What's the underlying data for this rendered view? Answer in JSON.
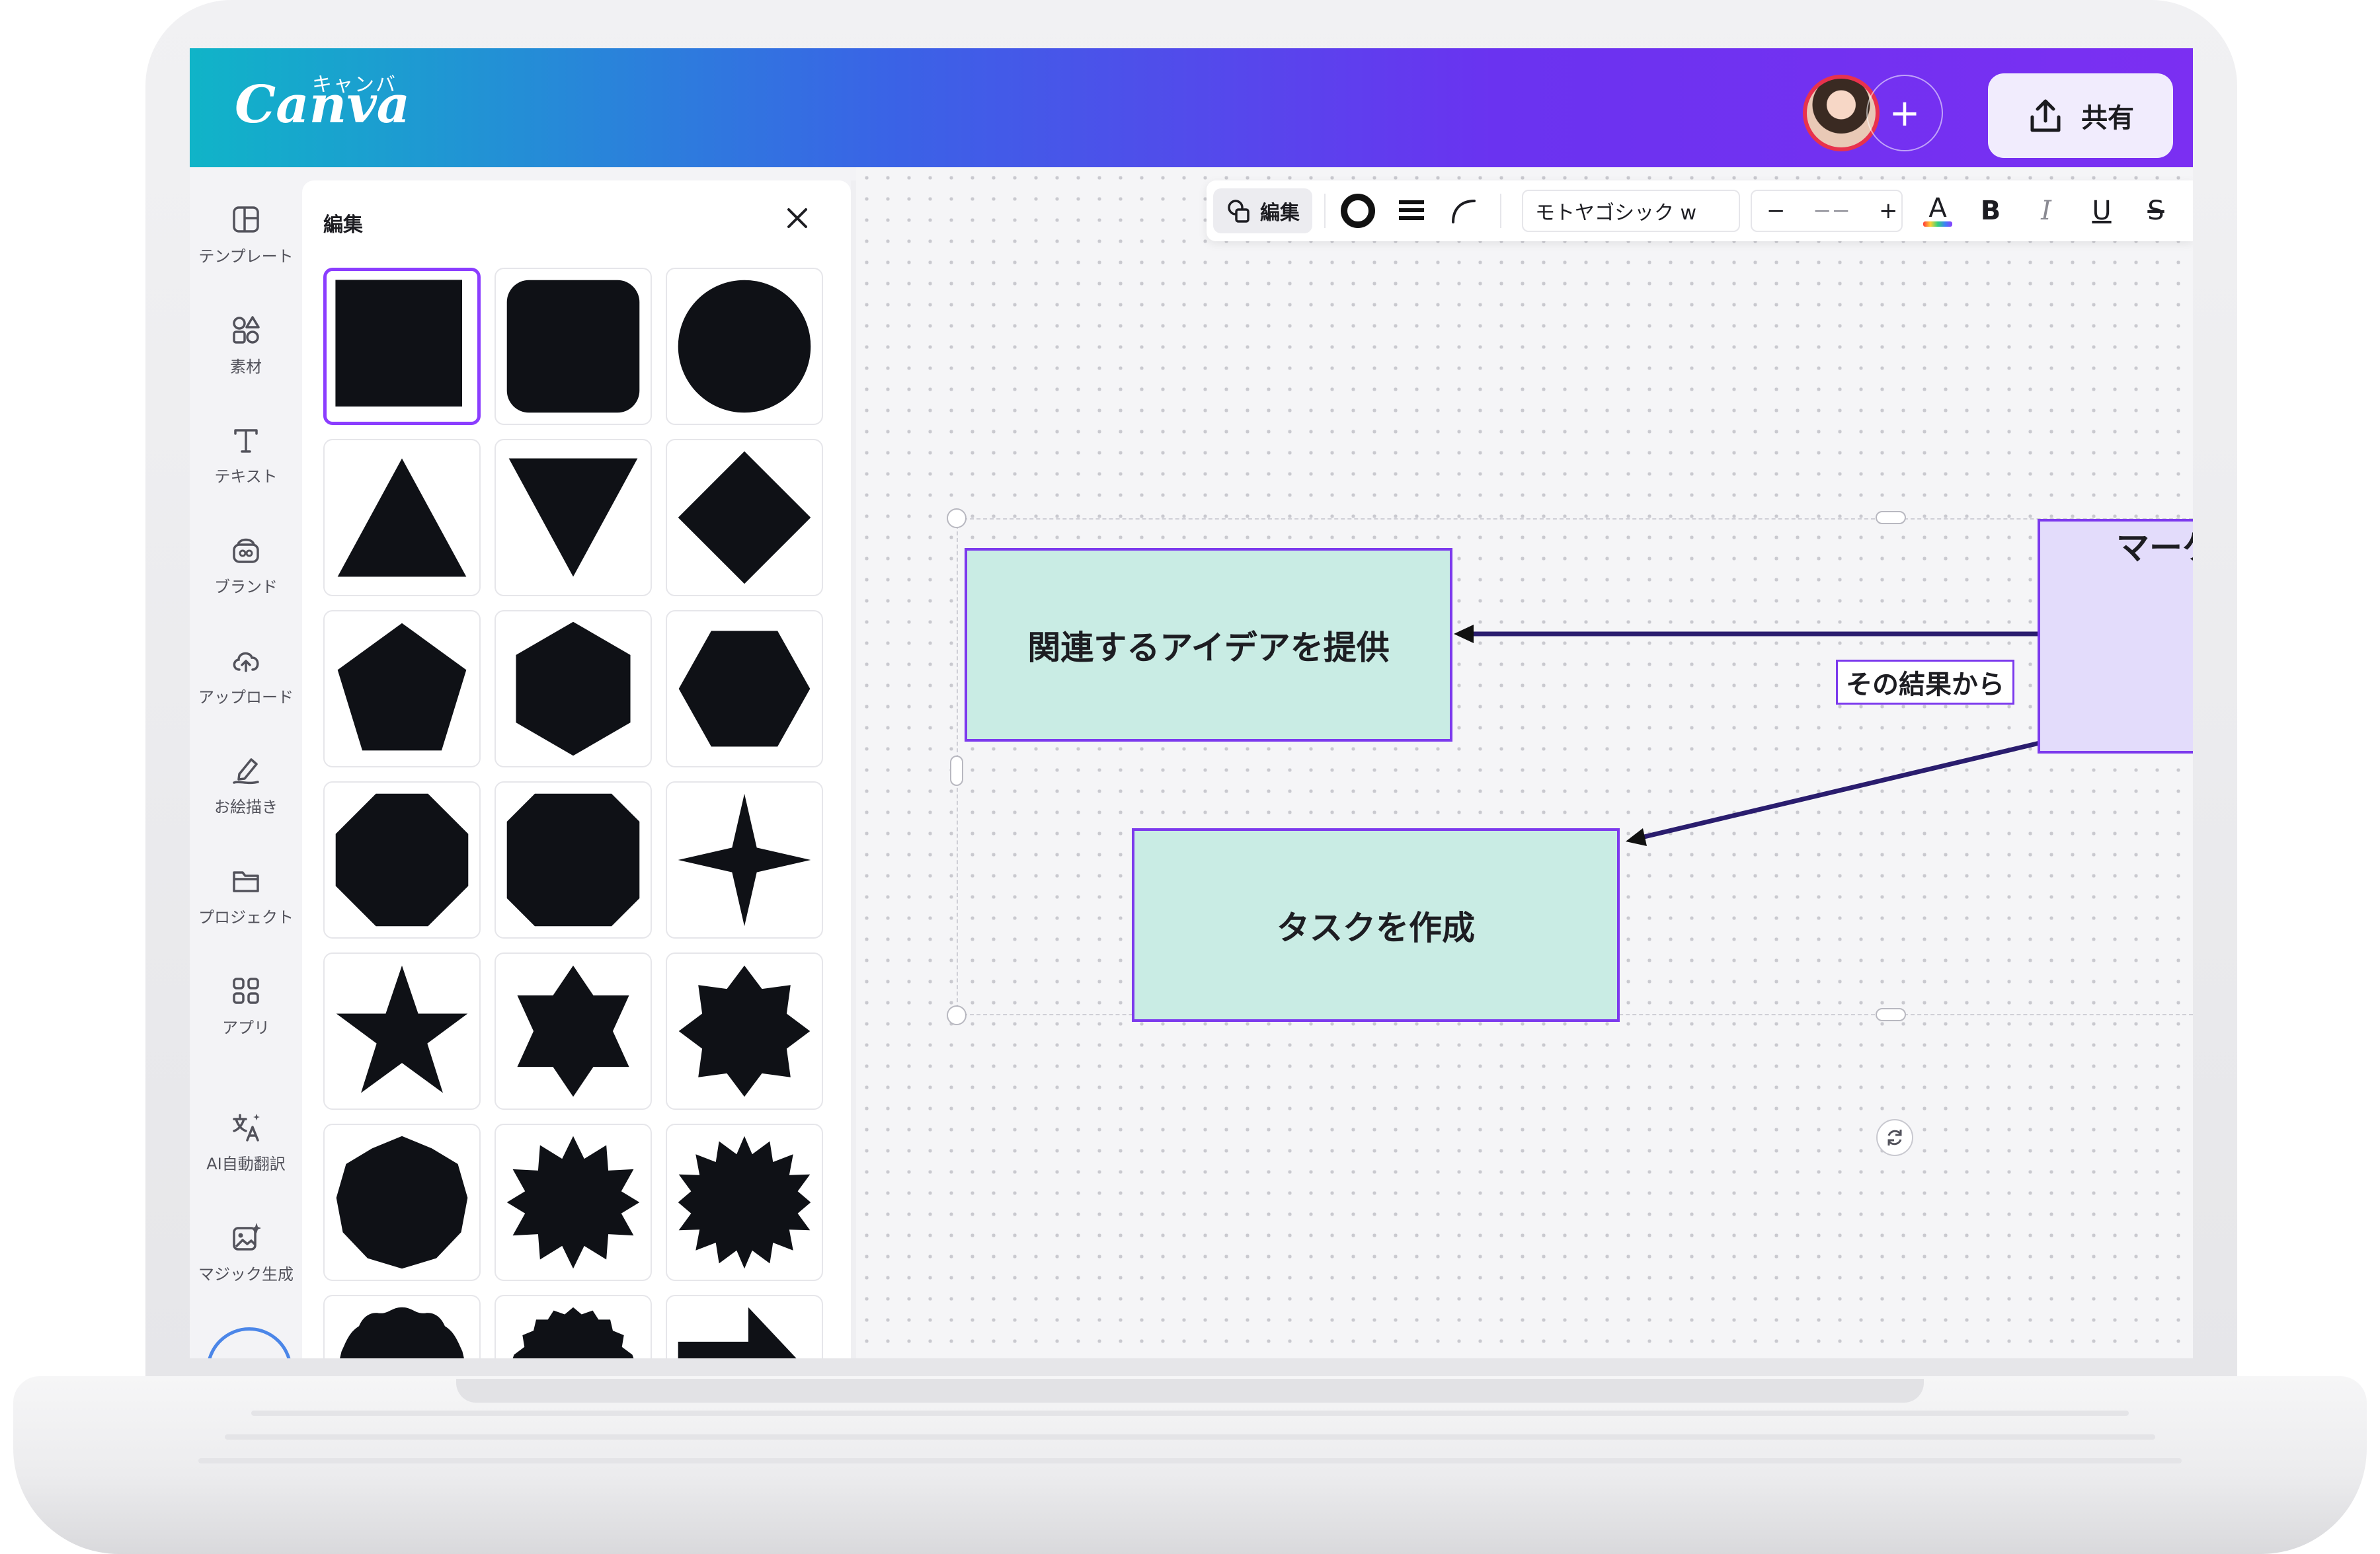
{
  "app": {
    "logo_text": "Canva",
    "logo_katakana": "キャンバ",
    "share_label": "共有",
    "add_collaborator_label": "+"
  },
  "sidebar": {
    "items": [
      {
        "label": "テンプレート",
        "icon": "template-icon"
      },
      {
        "label": "素材",
        "icon": "elements-icon"
      },
      {
        "label": "テキスト",
        "icon": "text-icon"
      },
      {
        "label": "ブランド",
        "icon": "brand-icon"
      },
      {
        "label": "アップロード",
        "icon": "upload-icon"
      },
      {
        "label": "お絵描き",
        "icon": "draw-icon"
      },
      {
        "label": "プロジェクト",
        "icon": "folder-icon"
      },
      {
        "label": "アプリ",
        "icon": "apps-icon"
      },
      {
        "label": "AI自動翻訳",
        "icon": "translate-icon"
      },
      {
        "label": "マジック生成",
        "icon": "magic-icon"
      }
    ]
  },
  "panel": {
    "title": "編集",
    "close_icon": "close-icon",
    "shapes": [
      "square",
      "rounded-square",
      "circle",
      "triangle",
      "inverted-triangle",
      "diamond",
      "pentagon",
      "hexagon-vertical",
      "hexagon-horizontal",
      "octagon",
      "octagon-cut",
      "four-point-star",
      "five-point-star",
      "six-point-star",
      "eight-point-star",
      "nonagon",
      "burst-12",
      "burst-16",
      "scallop-1",
      "scallop-2",
      "arrow-right"
    ]
  },
  "toolbar": {
    "edit_label": "編集",
    "font_name": "モトヤゴシック w",
    "size_minus": "−",
    "size_value": "−−",
    "size_plus": "+",
    "color_letter": "A",
    "bold": "B",
    "italic": "I",
    "underline": "U",
    "strike": "S"
  },
  "diagram": {
    "box1": "関連するアイデアを提供",
    "box2": "タスクを作成",
    "box3": "マーケ",
    "box3_line2": "マ",
    "edge_label": "その結果から"
  },
  "colors": {
    "accent": "#7c3aed",
    "mint": "#c9ece4",
    "lavender": "#e3dcfb",
    "gradient_start": "#10b4c8",
    "gradient_end": "#7b2ff2"
  }
}
